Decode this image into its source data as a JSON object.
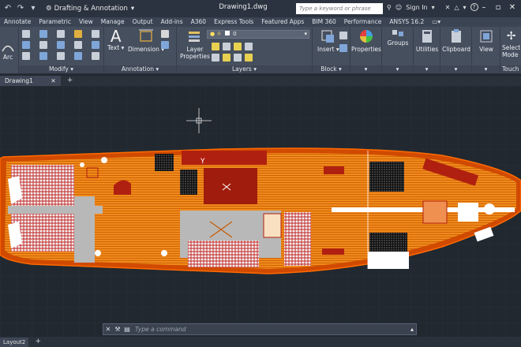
{
  "titlebar": {
    "workspace": "Drafting & Annotation",
    "document_title": "Drawing1.dwg",
    "search_placeholder": "Type a keyword or phrase",
    "sign_in": "Sign In"
  },
  "ribbon_tabs": [
    {
      "label": "Annotate"
    },
    {
      "label": "Parametric"
    },
    {
      "label": "View"
    },
    {
      "label": "Manage"
    },
    {
      "label": "Output"
    },
    {
      "label": "Add-ins"
    },
    {
      "label": "A360"
    },
    {
      "label": "Express Tools"
    },
    {
      "label": "Featured Apps"
    },
    {
      "label": "BIM 360"
    },
    {
      "label": "Performance"
    },
    {
      "label": "ANSYS 16.2"
    }
  ],
  "ribbon": {
    "arc_label": "Arc",
    "modify_label": "Modify",
    "text_label": "Text",
    "dimension_label": "Dimension",
    "annotation_label": "Annotation",
    "layer_properties_label": "Layer\nProperties",
    "layer_combo_value": "0",
    "layers_label": "Layers",
    "insert_label": "Insert",
    "block_label": "Block",
    "properties_label": "Properties",
    "groups_label": "Groups",
    "utilities_label": "Utilities",
    "clipboard_label": "Clipboard",
    "view_label": "View",
    "select_mode_label": "Select\nMode",
    "touch_label": "Touch"
  },
  "file_tabs": {
    "active": "Drawing1"
  },
  "command_line": {
    "placeholder": "Type a command"
  },
  "layout_tabs": {
    "items": [
      "Layout2"
    ]
  },
  "drawing_labels": {
    "y_marker": "Y"
  },
  "colors": {
    "deck_orange": "#f07a10",
    "hull_outline": "#d04a00",
    "cabin_red": "#b02010",
    "grey_room": "#b8b8b8"
  }
}
